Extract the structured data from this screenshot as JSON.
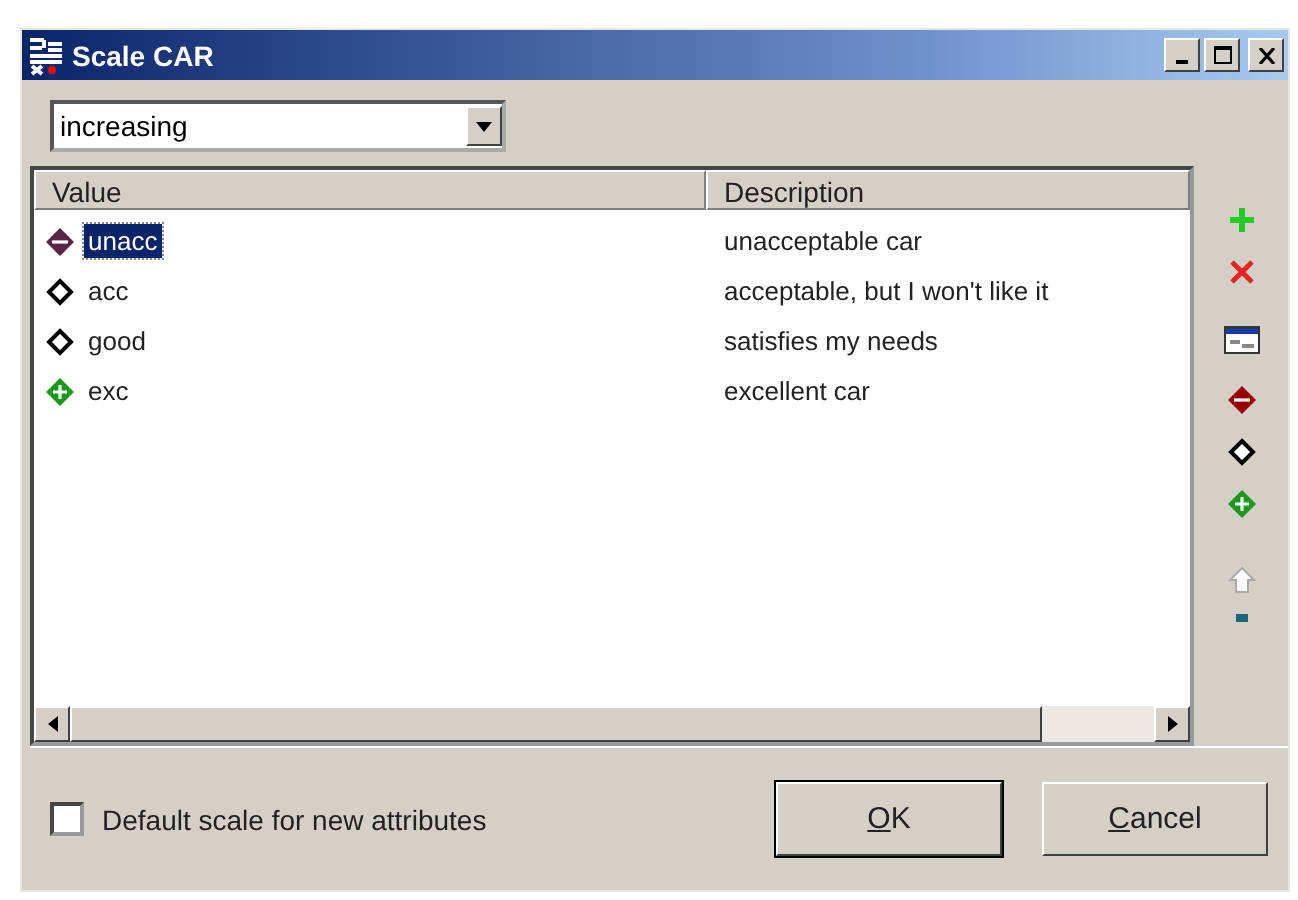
{
  "window": {
    "title": "Scale CAR"
  },
  "order_dropdown": {
    "value": "increasing"
  },
  "table": {
    "columns": [
      "Value",
      "Description"
    ],
    "rows": [
      {
        "kind": "negative",
        "value": "unacc",
        "description": "unacceptable car",
        "selected": true
      },
      {
        "kind": "neutral",
        "value": "acc",
        "description": "acceptable, but I won't like it",
        "selected": false
      },
      {
        "kind": "neutral",
        "value": "good",
        "description": "satisfies my needs",
        "selected": false
      },
      {
        "kind": "positive",
        "value": "exc",
        "description": "excellent car",
        "selected": false
      }
    ]
  },
  "toolbar": [
    {
      "kind": "add"
    },
    {
      "kind": "delete"
    },
    {
      "kind": "edit"
    },
    {
      "kind": "negative"
    },
    {
      "kind": "neutral"
    },
    {
      "kind": "positive"
    },
    {
      "kind": "up",
      "disabled": true
    },
    {
      "kind": "cut"
    }
  ],
  "default_scale": {
    "label": "Default scale for new attributes",
    "checked": false
  },
  "buttons": [
    {
      "key": "O",
      "rest": "K"
    },
    {
      "key": "C",
      "rest": "ancel"
    }
  ]
}
